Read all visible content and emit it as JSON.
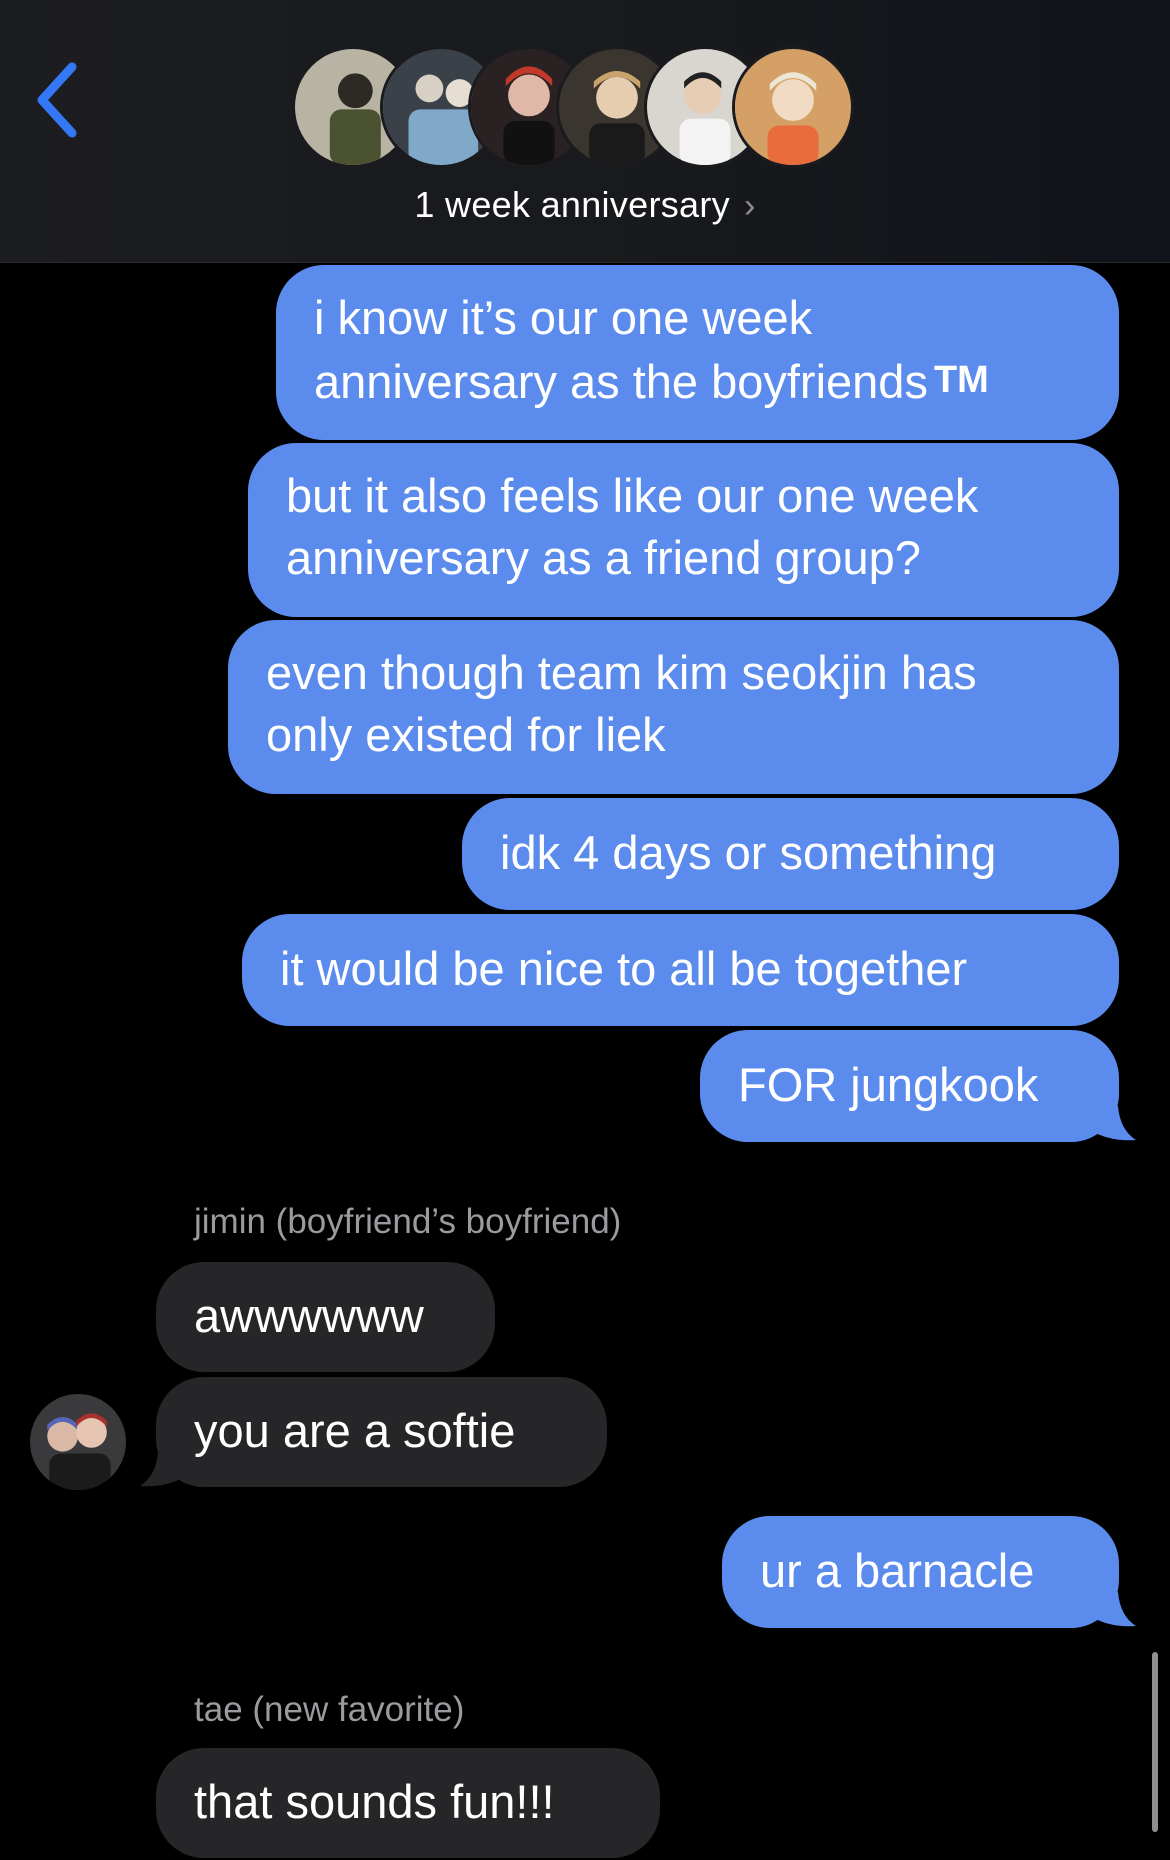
{
  "header": {
    "back_icon": "chevron-left-icon",
    "group_name": "1 week anniversary",
    "chevron": "›",
    "accent_color": "#3478f6",
    "member_count_avatars": 6
  },
  "messages": {
    "m1_line1": "i know it’s our one week",
    "m1_line2": "anniversary as the boyfriends",
    "m1_tm": "TM",
    "m2_line1": "but it also feels like our one week",
    "m2_line2": "anniversary as a friend group?",
    "m3_line1": "even though team kim seokjin has",
    "m3_line2": "only existed for liek",
    "m4": "idk 4 days or something",
    "m5": "it would be nice to all be together",
    "m6": "FOR jungkook",
    "sender_jimin": "jimin (boyfriend’s boyfriend)",
    "m7": "awwwwww",
    "m8": "you are a softie",
    "m9": "ur a barnacle",
    "sender_tae": "tae (new favorite)",
    "m10": "that sounds fun!!!"
  },
  "colors": {
    "outgoing_bubble": "#5b8ced",
    "incoming_bubble": "#262628",
    "background": "#000000"
  }
}
